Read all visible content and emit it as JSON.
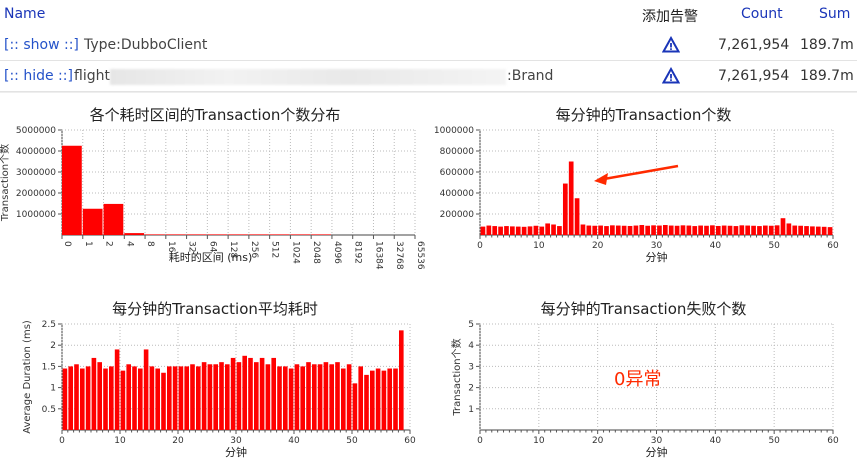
{
  "table": {
    "headers": {
      "name": "Name",
      "alert": "添加告警",
      "count": "Count",
      "sum": "Sum"
    },
    "rows": [
      {
        "toggle": "[:: show ::]",
        "type": "Type:DubboClient",
        "count": "7,261,954",
        "sum": "189.7m"
      },
      {
        "toggle": "[:: hide ::]",
        "type_prefix": "flight",
        "type_suffix": ":Brand",
        "count": "7,261,954",
        "sum": "189.7m"
      }
    ]
  },
  "icons": {
    "alert": "warning-triangle-icon"
  },
  "colors": {
    "bar": "#ff0000",
    "link": "#2452c9",
    "header": "#1a35b8",
    "annotation": "#ff2a00"
  },
  "chart_data": [
    {
      "type": "bar",
      "title": "各个耗时区间的Transaction个数分布",
      "xlabel": "耗时的区间 (ms)",
      "ylabel": "Transaction个数",
      "categories": [
        "0",
        "1",
        "2",
        "4",
        "8",
        "16",
        "32",
        "64",
        "128",
        "256",
        "512",
        "1024",
        "2048",
        "4096",
        "8192",
        "16384",
        "32768",
        "65536"
      ],
      "values": [
        4250000,
        1250000,
        1480000,
        90000,
        8000,
        2000,
        1000,
        500,
        200,
        100,
        50,
        20,
        10,
        0,
        0,
        0,
        0
      ],
      "yticks": [
        "1000000",
        "2000000",
        "3000000",
        "4000000",
        "5000000"
      ],
      "ylim": [
        0,
        5000000
      ],
      "grid": true
    },
    {
      "type": "bar",
      "title": "每分钟的Transaction个数",
      "xlabel": "分钟",
      "ylabel": "Transaction个数",
      "x": [
        1,
        2,
        3,
        4,
        5,
        6,
        7,
        8,
        9,
        10,
        11,
        12,
        13,
        14,
        15,
        16,
        17,
        18,
        19,
        20,
        21,
        22,
        23,
        24,
        25,
        26,
        27,
        28,
        29,
        30,
        31,
        32,
        33,
        34,
        35,
        36,
        37,
        38,
        39,
        40,
        41,
        42,
        43,
        44,
        45,
        46,
        47,
        48,
        49,
        50,
        51,
        52,
        53,
        54,
        55,
        56,
        57,
        58,
        59,
        60
      ],
      "values": [
        80000,
        90000,
        85000,
        80000,
        85000,
        82000,
        80000,
        78000,
        82000,
        88000,
        80000,
        110000,
        100000,
        85000,
        490000,
        700000,
        350000,
        100000,
        90000,
        88000,
        90000,
        85000,
        92000,
        90000,
        88000,
        86000,
        90000,
        95000,
        88000,
        92000,
        90000,
        95000,
        90000,
        88000,
        92000,
        90000,
        85000,
        90000,
        88000,
        92000,
        86000,
        90000,
        88000,
        85000,
        92000,
        90000,
        88000,
        85000,
        90000,
        88000,
        92000,
        160000,
        110000,
        90000,
        88000,
        85000,
        82000,
        80000,
        78000,
        75000
      ],
      "xticks": [
        "0",
        "10",
        "20",
        "30",
        "40",
        "50",
        "60"
      ],
      "yticks": [
        "200000",
        "400000",
        "600000",
        "800000",
        "1000000"
      ],
      "ylim": [
        0,
        1000000
      ],
      "grid": true
    },
    {
      "type": "bar",
      "title": "每分钟的Transaction平均耗时",
      "xlabel": "分钟",
      "ylabel": "Average Duration (ms)",
      "x": [
        1,
        2,
        3,
        4,
        5,
        6,
        7,
        8,
        9,
        10,
        11,
        12,
        13,
        14,
        15,
        16,
        17,
        18,
        19,
        20,
        21,
        22,
        23,
        24,
        25,
        26,
        27,
        28,
        29,
        30,
        31,
        32,
        33,
        34,
        35,
        36,
        37,
        38,
        39,
        40,
        41,
        42,
        43,
        44,
        45,
        46,
        47,
        48,
        49,
        50,
        51,
        52,
        53,
        54,
        55,
        56,
        57,
        58,
        59,
        60
      ],
      "values": [
        1.45,
        1.5,
        1.55,
        1.45,
        1.5,
        1.7,
        1.6,
        1.45,
        1.5,
        1.9,
        1.4,
        1.55,
        1.5,
        1.45,
        1.9,
        1.5,
        1.45,
        1.35,
        1.5,
        1.5,
        1.5,
        1.5,
        1.55,
        1.5,
        1.6,
        1.55,
        1.55,
        1.6,
        1.55,
        1.7,
        1.6,
        1.75,
        1.7,
        1.6,
        1.7,
        1.55,
        1.7,
        1.5,
        1.5,
        1.45,
        1.55,
        1.5,
        1.6,
        1.55,
        1.55,
        1.6,
        1.55,
        1.6,
        1.45,
        1.55,
        1.1,
        1.5,
        1.3,
        1.4,
        1.45,
        1.4,
        1.45,
        1.45,
        2.35,
        0
      ],
      "xticks": [
        "0",
        "10",
        "20",
        "30",
        "40",
        "50",
        "60"
      ],
      "yticks": [
        "0.5",
        "1",
        "1.5",
        "2",
        "2.5"
      ],
      "ylim": [
        0,
        2.5
      ],
      "grid": true
    },
    {
      "type": "bar",
      "title": "每分钟的Transaction失败个数",
      "xlabel": "分钟",
      "ylabel": "Transaction个数",
      "annotation": "0异常",
      "x": [],
      "values": [],
      "xticks": [
        "0",
        "10",
        "20",
        "30",
        "40",
        "50",
        "60"
      ],
      "yticks": [
        "1",
        "2",
        "3",
        "4",
        "5"
      ],
      "ylim": [
        0,
        5
      ],
      "grid": true
    }
  ]
}
